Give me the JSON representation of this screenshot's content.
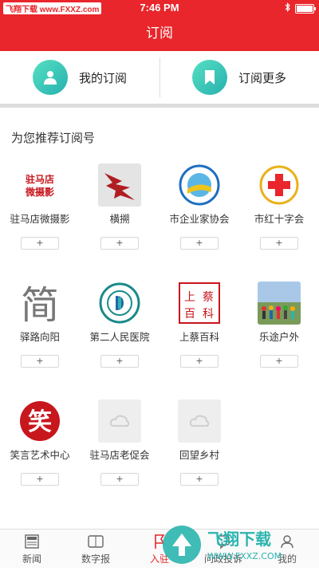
{
  "status_bar": {
    "watermark": "飞翔下载 www.FXXZ.com",
    "time": "7:46 PM"
  },
  "nav": {
    "title": "订阅"
  },
  "top_actions": [
    {
      "label": "我的订阅",
      "icon": "person-icon"
    },
    {
      "label": "订阅更多",
      "icon": "bookmark-icon"
    }
  ],
  "section": {
    "title": "为您推荐订阅号"
  },
  "subscriptions": [
    {
      "name": "驻马店微摄影",
      "logo_text": "驻马店微摄影"
    },
    {
      "name": "横搠",
      "logo_text": ""
    },
    {
      "name": "市企业家协会",
      "logo_text": ""
    },
    {
      "name": "市红十字会",
      "logo_text": ""
    },
    {
      "name": "驿路向阳",
      "logo_text": "简"
    },
    {
      "name": "第二人民医院",
      "logo_text": ""
    },
    {
      "name": "上蔡百科",
      "logo_text": "上蔡百科"
    },
    {
      "name": "乐途户外",
      "logo_text": ""
    },
    {
      "name": "笑言艺术中心",
      "logo_text": "笑"
    },
    {
      "name": "驻马店老促会",
      "logo_text": ""
    },
    {
      "name": "回望乡村",
      "logo_text": ""
    }
  ],
  "add_symbol": "+",
  "tabs": [
    {
      "label": "新闻",
      "icon": "newspaper-icon",
      "active": false
    },
    {
      "label": "数字报",
      "icon": "digital-paper-icon",
      "active": false
    },
    {
      "label": "入驻",
      "icon": "flag-icon",
      "active": true
    },
    {
      "label": "问政投诉",
      "icon": "complaint-icon",
      "active": false
    },
    {
      "label": "我的",
      "icon": "profile-icon",
      "active": false
    }
  ],
  "watermark_badge": {
    "text": "飞翔下载",
    "url": "WWW.FXXZ.COM"
  },
  "colors": {
    "brand_red": "#e8262b",
    "accent_teal": "#2bb5ae"
  }
}
